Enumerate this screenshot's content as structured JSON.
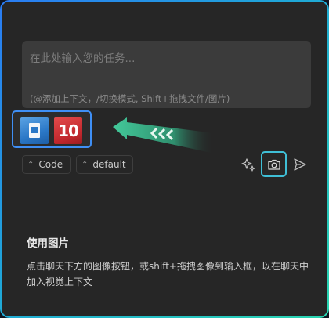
{
  "input": {
    "placeholder": "在此处输入您的任务...",
    "hint": "(@添加上下文，/切换模式, Shift+拖拽文件/图片)"
  },
  "attachments": [
    {
      "icon": "document-image-icon"
    },
    {
      "text": "10",
      "icon": "red-calendar-image-icon"
    }
  ],
  "chips": {
    "mode": "Code",
    "model": "default"
  },
  "toolbar": {
    "enhance_icon": "sparkle-icon",
    "image_icon": "camera-icon",
    "send_icon": "send-icon"
  },
  "tip": {
    "title": "使用图片",
    "description": "点击聊天下方的图像按钮，或shift+拖拽图像到输入框，以在聊天中加入视觉上下文"
  },
  "colors": {
    "panel_bg": "#262626",
    "accent_blue": "#3f8ff5",
    "accent_teal": "#3fbfd6",
    "arrow_green": "#43c99a"
  }
}
